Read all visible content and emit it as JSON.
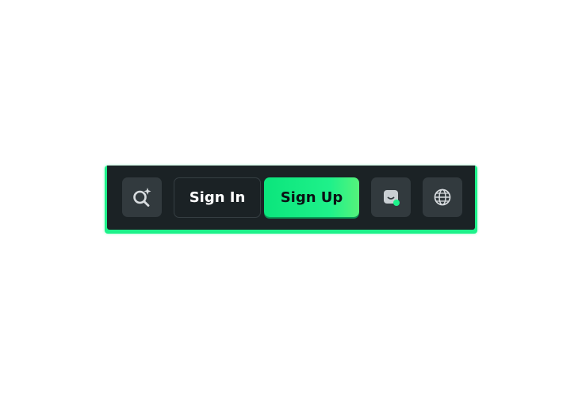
{
  "toolbar": {
    "search_icon": "search-sparkle-icon",
    "signin_label": "Sign In",
    "signup_label": "Sign Up",
    "chat_icon": "chat-bubble-icon",
    "language_icon": "globe-icon"
  },
  "colors": {
    "toolbar_bg": "#1b2225",
    "icon_button_bg": "#323a3e",
    "accent_green": "#1df28a",
    "signup_text": "#0b1114",
    "signin_text": "#ffffff"
  }
}
